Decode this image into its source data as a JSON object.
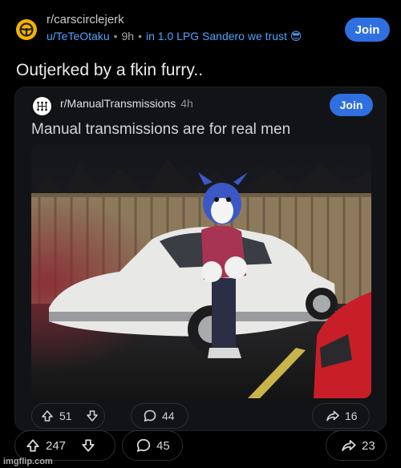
{
  "post": {
    "subreddit": "r/carscirclejerk",
    "user": "u/TeTeOtaku",
    "time": "9h",
    "flair": "in 1.0 LPG Sandero we trust 😎",
    "join_label": "Join",
    "title": "Outjerked by a fkin furry.."
  },
  "embed": {
    "subreddit": "r/ManualTransmissions",
    "time": "4h",
    "join_label": "Join",
    "title": "Manual transmissions are for real men",
    "upvotes": "51",
    "comments": "44",
    "shares": "16"
  },
  "actions": {
    "upvotes": "247",
    "comments": "45",
    "shares": "23"
  },
  "watermark": "imgflip.com",
  "colors": {
    "accent_blue": "#2f6fe0",
    "link_blue": "#4fa3ff",
    "subreddit_icon": "#f5b301",
    "background": "#000000"
  },
  "icons": [
    "steering-wheel-icon",
    "gear-shift-icon",
    "upvote-icon",
    "downvote-icon",
    "comment-icon",
    "share-icon"
  ]
}
